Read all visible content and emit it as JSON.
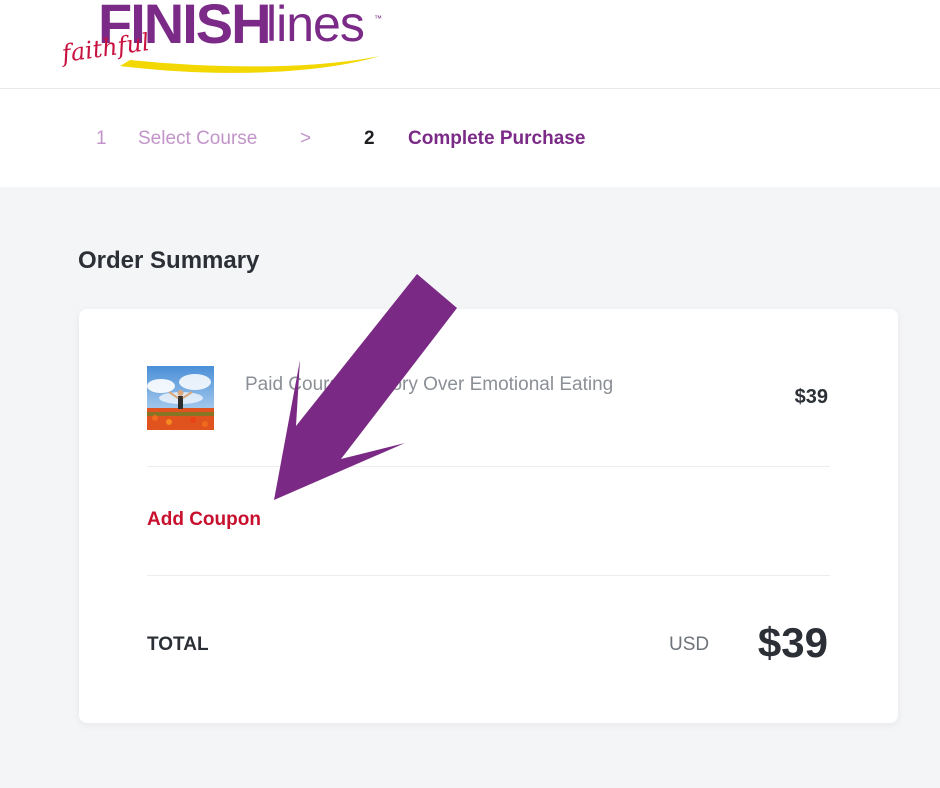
{
  "brand": {
    "logo_main": "FINISH",
    "logo_suffix": "lines",
    "logo_tm": "™",
    "logo_script": "faithful",
    "colors": {
      "purple": "#7b2a87",
      "red": "#c8123f",
      "yellow": "#f2d800"
    }
  },
  "steps": [
    {
      "number": "1",
      "label": "Select Course",
      "state": "done"
    },
    {
      "separator": ">"
    },
    {
      "number": "2",
      "label": "Complete Purchase",
      "state": "active"
    }
  ],
  "order_summary": {
    "title": "Order Summary",
    "item": {
      "name": "Paid Course: Victory Over Emotional Eating",
      "price": "$39",
      "thumbnail_icon": "person-in-flower-field-image"
    },
    "add_coupon_label": "Add Coupon",
    "total_label": "TOTAL",
    "currency": "USD",
    "total_amount": "$39"
  },
  "overlay": {
    "arrow_icon": "purple-arrow-pointing-to-add-coupon",
    "arrow_color": "#7a2a84"
  }
}
